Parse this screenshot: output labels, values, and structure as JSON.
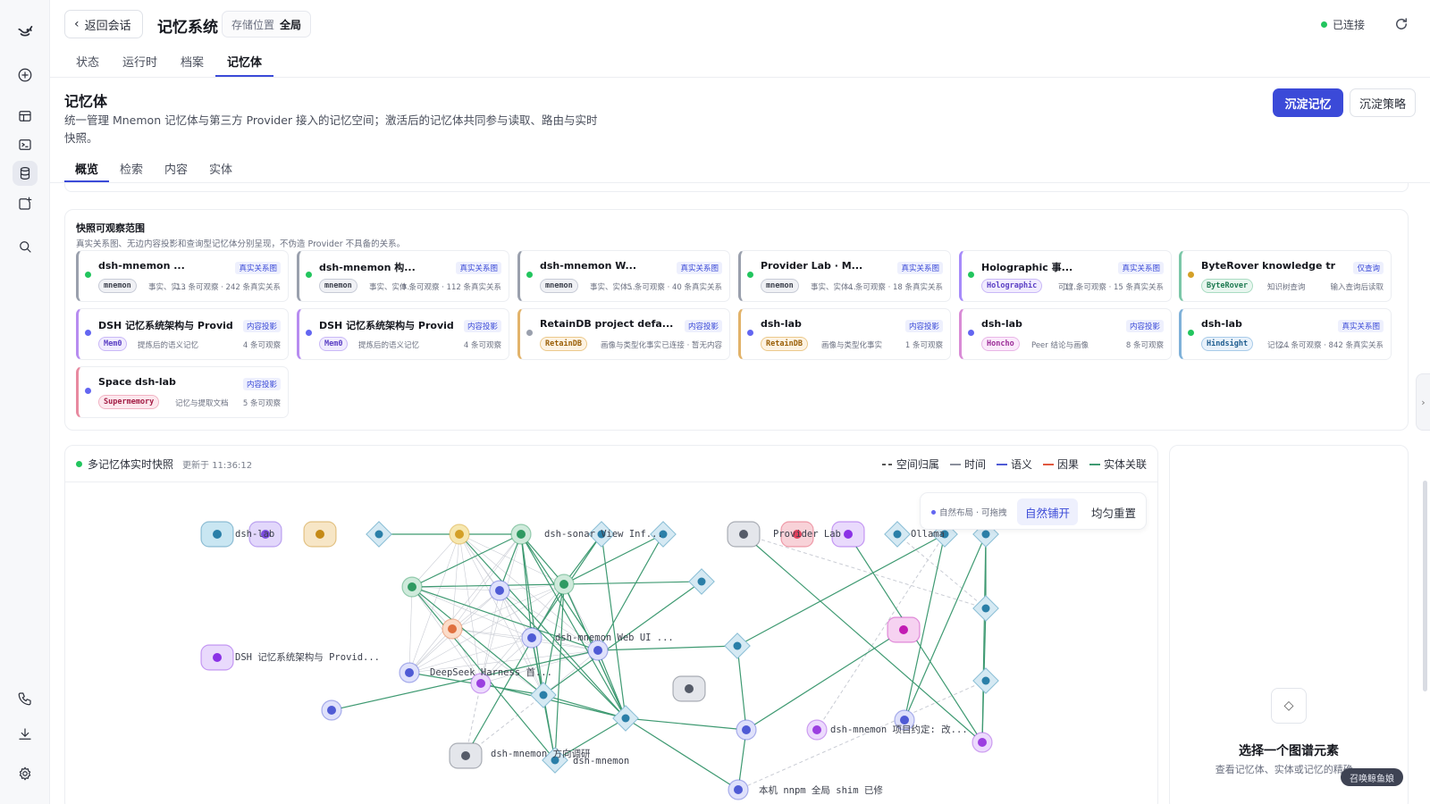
{
  "header": {
    "back_label": "返回会话",
    "title": "记忆系统",
    "store_label": "存储位置",
    "store_value": "全局",
    "connection": "已连接"
  },
  "top_tabs": [
    "状态",
    "运行时",
    "档案",
    "记忆体"
  ],
  "section": {
    "title": "记忆体",
    "description": "统一管理 Mnemon 记忆体与第三方 Provider 接入的记忆空间；激活后的记忆体共同参与读取、路由与实时快照。",
    "primary_button": "沉淀记忆",
    "secondary_button": "沉淀策略"
  },
  "sub_tabs": [
    "概览",
    "检索",
    "内容",
    "实体"
  ],
  "scope": {
    "title": "快照可观察范围",
    "subtitle": "真实关系图、无边内容投影和查询型记忆体分别呈现，不伪造 Provider 不具备的关系。",
    "cards": [
      {
        "title": "dsh-mnemon ...",
        "badge": "真实关系图",
        "provider": "mnemon",
        "desc": "事实、实...",
        "stat": "13 条可观察 · 242 条真实关系",
        "accent": "#9aa0ad",
        "dot": "#22c55e",
        "pill_bg": "#f0f1f5",
        "pill_fg": "#3b3f4b",
        "pill_bd": "#c7cbd6"
      },
      {
        "title": "dsh-mnemon 构...",
        "badge": "真实关系图",
        "provider": "mnemon",
        "desc": "事实、实体...",
        "stat": "9 条可观察 · 112 条真实关系",
        "accent": "#9aa0ad",
        "dot": "#22c55e",
        "pill_bg": "#f0f1f5",
        "pill_fg": "#3b3f4b",
        "pill_bd": "#c7cbd6"
      },
      {
        "title": "dsh-mnemon W...",
        "badge": "真实关系图",
        "provider": "mnemon",
        "desc": "事实、实体...",
        "stat": "5 条可观察 · 40 条真实关系",
        "accent": "#9aa0ad",
        "dot": "#22c55e",
        "pill_bg": "#f0f1f5",
        "pill_fg": "#3b3f4b",
        "pill_bd": "#c7cbd6"
      },
      {
        "title": "Provider Lab · M...",
        "badge": "真实关系图",
        "provider": "mnemon",
        "desc": "事实、实体...",
        "stat": "4 条可观察 · 18 条真实关系",
        "accent": "#9aa0ad",
        "dot": "#22c55e",
        "pill_bg": "#f0f1f5",
        "pill_fg": "#3b3f4b",
        "pill_bd": "#c7cbd6"
      },
      {
        "title": "Holographic 事...",
        "badge": "真实关系图",
        "provider": "Holographic",
        "desc": "可信...",
        "stat": "17 条可观察 · 15 条真实关系",
        "accent": "#a78bfa",
        "dot": "#22c55e",
        "pill_bg": "#f1ecfe",
        "pill_fg": "#5b3fc4",
        "pill_bd": "#c9b8f7"
      },
      {
        "title": "ByteRover knowledge tree",
        "badge": "仅查询",
        "provider": "ByteRover",
        "desc": "知识树查询",
        "stat": "输入查询后读取",
        "accent": "#7cc7a8",
        "dot": "#d4a027",
        "pill_bg": "#e9f6ef",
        "pill_fg": "#1f7a51",
        "pill_bd": "#a9dcc2"
      },
      {
        "title": "DSH 记忆系统架构与 Provide...",
        "badge": "内容投影",
        "provider": "Mem0",
        "desc": "提炼后的语义记忆",
        "stat": "4 条可观察",
        "accent": "#b78cf0",
        "dot": "#6366f1",
        "pill_bg": "#f1ecfe",
        "pill_fg": "#5b3fc4",
        "pill_bd": "#c9b8f7"
      },
      {
        "title": "DSH 记忆系统架构与 Provide...",
        "badge": "内容投影",
        "provider": "Mem0",
        "desc": "提炼后的语义记忆",
        "stat": "4 条可观察",
        "accent": "#b78cf0",
        "dot": "#6366f1",
        "pill_bg": "#f1ecfe",
        "pill_fg": "#5b3fc4",
        "pill_bd": "#c9b8f7"
      },
      {
        "title": "RetainDB project defa...",
        "badge": "内容投影",
        "provider": "RetainDB",
        "desc": "画像与类型化事实",
        "stat": "已连接 · 暂无内容",
        "accent": "#e2b36a",
        "dot": "#9aa0ad",
        "pill_bg": "#fdf3e3",
        "pill_fg": "#9a5f07",
        "pill_bd": "#ecc98b"
      },
      {
        "title": "dsh-lab",
        "badge": "内容投影",
        "provider": "RetainDB",
        "desc": "画像与类型化事实",
        "stat": "1 条可观察",
        "accent": "#e2b36a",
        "dot": "#6366f1",
        "pill_bg": "#fdf3e3",
        "pill_fg": "#9a5f07",
        "pill_bd": "#ecc98b"
      },
      {
        "title": "dsh-lab",
        "badge": "内容投影",
        "provider": "Honcho",
        "desc": "Peer 结论与画像",
        "stat": "8 条可观察",
        "accent": "#d98bd6",
        "dot": "#6366f1",
        "pill_bg": "#fbeafb",
        "pill_fg": "#9b2c97",
        "pill_bd": "#e9b6e7"
      },
      {
        "title": "dsh-lab",
        "badge": "真实关系图",
        "provider": "Hindsight",
        "desc": "记忆...",
        "stat": "24 条可观察 · 842 条真实关系",
        "accent": "#7fb1d9",
        "dot": "#22c55e",
        "pill_bg": "#e9f2fb",
        "pill_fg": "#1f5d8f",
        "pill_bd": "#a8cbe9"
      },
      {
        "title": "Space dsh-lab",
        "badge": "内容投影",
        "provider": "Supermemory",
        "desc": "记忆与提取文档",
        "stat": "5 条可观察",
        "accent": "#e88aa0",
        "dot": "#6366f1",
        "pill_bg": "#fde8ee",
        "pill_fg": "#a31c44",
        "pill_bd": "#f1b3c3"
      }
    ]
  },
  "graph": {
    "title": "多记忆体实时快照",
    "updated": "更新于 11:36:12",
    "legend": [
      {
        "label": "空间归属",
        "color": "#7a7f8c"
      },
      {
        "label": "时间",
        "color": "#8a8f9c"
      },
      {
        "label": "语义",
        "color": "#4f5bd5"
      },
      {
        "label": "因果",
        "color": "#e0583f"
      },
      {
        "label": "实体关联",
        "color": "#3f9a72"
      }
    ],
    "mode_label": "自然布局 · 可拖拽",
    "btn_natural": "自然铺开",
    "btn_reset": "均匀重置",
    "labels": [
      "dsh-lab",
      "dsh-sonar View Inf...",
      "Provider Lab",
      "Ollama",
      "dsh-mnemon Web UI ...",
      "DSH 记忆系统架构与 Provid...",
      "DeepSeek Harness 首...",
      "dsh-mnemon 方向调研",
      "dsh-mnemon",
      "dsh-mnemon 项目约定: 改...",
      "本机 nnpm 全局 shim 已修"
    ]
  },
  "detail": {
    "title": "选择一个图谱元素",
    "desc": "查看记忆体、实体或记忆的精确..."
  },
  "pet_label": "召唤鲸鱼娘"
}
